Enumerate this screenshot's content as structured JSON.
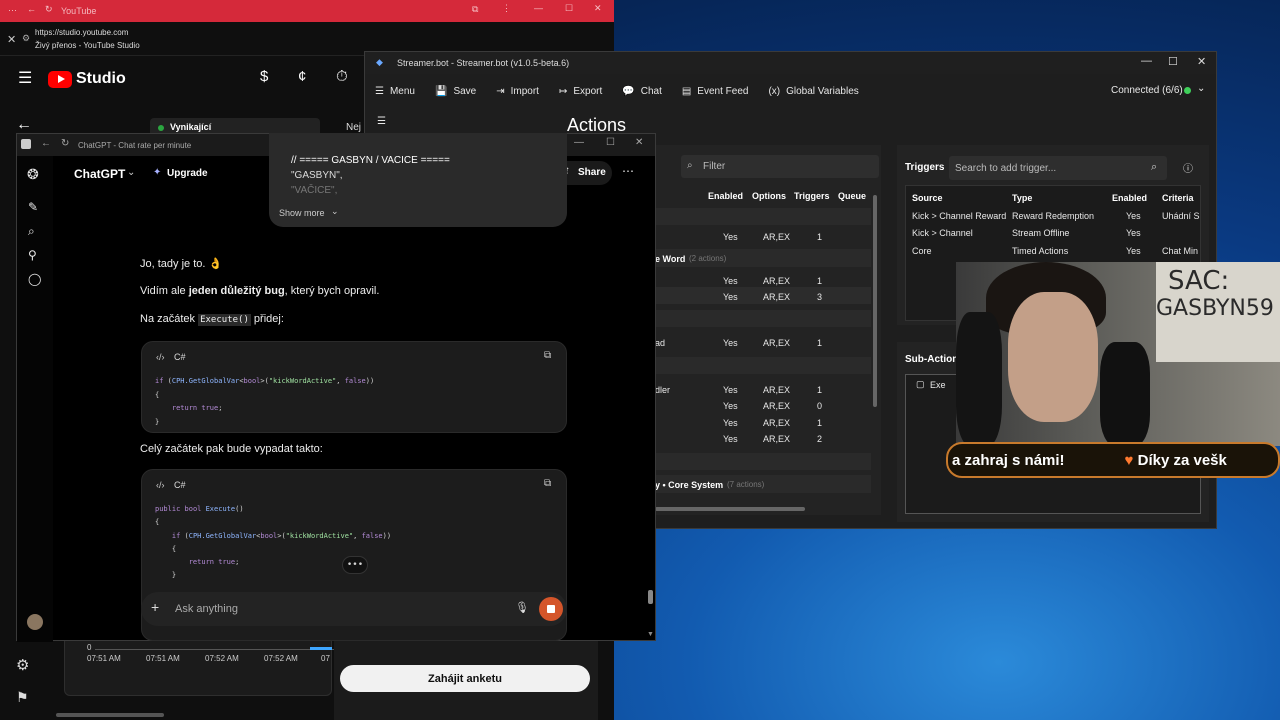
{
  "youtube": {
    "title": "YouTube",
    "url": "https://studio.youtube.com",
    "page_title": "Živý přenos - YouTube Studio",
    "logo": "Studio",
    "card_label": "Vynikající",
    "card_label2": "Nej",
    "times": [
      "07:51 AM",
      "07:51 AM",
      "07:52 AM",
      "07:52 AM",
      "07"
    ],
    "zero": "0",
    "poll_button": "Zahájit anketu"
  },
  "streamerbot": {
    "title": "Streamer.bot - Streamer.bot (v1.0.5-beta.6)",
    "menu": [
      "Menu",
      "Save",
      "Import",
      "Export",
      "Chat",
      "Event Feed",
      "Global Variables"
    ],
    "status": "Connected (6/6)",
    "heading": "Actions",
    "filter_placeholder": "Filter",
    "actions_cols": [
      "Enabled",
      "Options",
      "Triggers",
      "Queue"
    ],
    "action_rows": [
      {
        "name": "",
        "enabled": "",
        "options": "",
        "triggers": ""
      },
      {
        "name": "",
        "enabled": "Yes",
        "options": "AR,EX",
        "triggers": "1"
      },
      {
        "name": "e Word",
        "group_count": "(2 actions)"
      },
      {
        "name": "",
        "enabled": "Yes",
        "options": "AR,EX",
        "triggers": "1"
      },
      {
        "name": "",
        "enabled": "Yes",
        "options": "AR,EX",
        "triggers": "3"
      },
      {
        "name": ""
      },
      {
        "name": "ad",
        "enabled": "Yes",
        "options": "AR,EX",
        "triggers": "1"
      },
      {
        "name": ""
      },
      {
        "name": "dler",
        "enabled": "Yes",
        "options": "AR,EX",
        "triggers": "1"
      },
      {
        "name": "",
        "enabled": "Yes",
        "options": "AR,EX",
        "triggers": "0"
      },
      {
        "name": "",
        "enabled": "Yes",
        "options": "AR,EX",
        "triggers": "1"
      },
      {
        "name": "",
        "enabled": "Yes",
        "options": "AR,EX",
        "triggers": "2"
      },
      {
        "name": ""
      },
      {
        "name": "y • Core System",
        "group_count": "(7 actions)"
      }
    ],
    "triggers_label": "Triggers",
    "trigger_search": "Search to add trigger...",
    "trigger_cols": [
      "Source",
      "Type",
      "Enabled",
      "Criteria"
    ],
    "trigger_rows": [
      {
        "source": "Kick > Channel Reward",
        "type": "Reward Redemption",
        "enabled": "Yes",
        "criteria": "Uhádní Sl"
      },
      {
        "source": "Kick > Channel",
        "type": "Stream Offline",
        "enabled": "Yes",
        "criteria": ""
      },
      {
        "source": "Core",
        "type": "Timed Actions",
        "enabled": "Yes",
        "criteria": "Chat Min"
      }
    ],
    "subactions_label": "Sub-Actions",
    "sub_item": "Exe"
  },
  "chatgpt": {
    "title": "ChatGPT - Chat rate per minute",
    "brand": "ChatGPT",
    "upgrade": "Upgrade",
    "share": "Share",
    "quote_lines": [
      "// ===== GASBYN / VACICE =====",
      "\"GASBYN\",",
      "\"VAČICE\","
    ],
    "show_more": "Show more",
    "msg1": "Jo, tady je to. 👌",
    "msg2_a": "Vidím ale ",
    "msg2_b": "jeden důležitý bug",
    "msg2_c": ", který bych opravil.",
    "msg3_a": "Na začátek ",
    "msg3_code": "Execute()",
    "msg3_b": " přidej:",
    "lang": "C#",
    "msg4": "Celý začátek pak bude vypadat takto:",
    "input_placeholder": "Ask anything"
  },
  "overlay": {
    "sign_line1": "SAC:",
    "sign_line2": "GASBYN59",
    "banner_a": "a zahraj s námi!",
    "banner_b": "Díky za vešk"
  }
}
